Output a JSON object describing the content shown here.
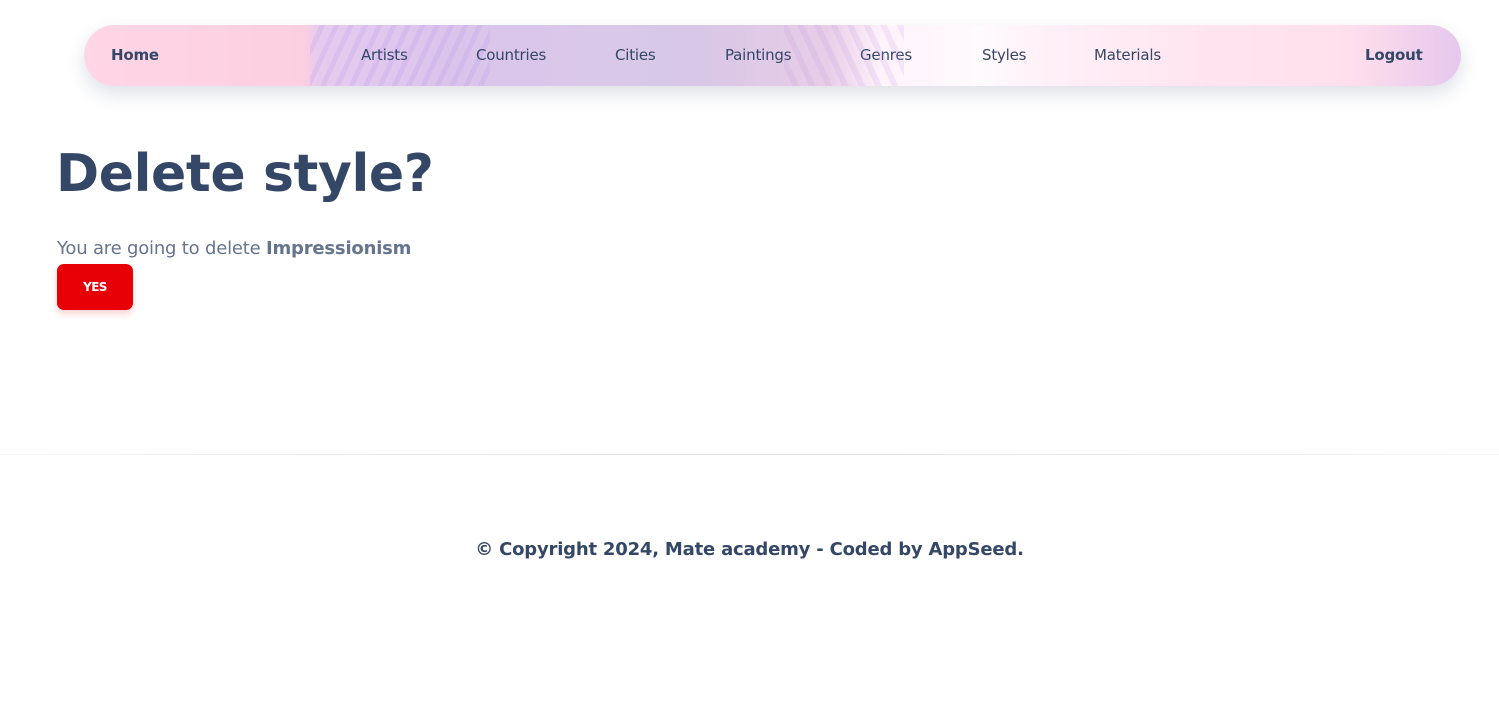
{
  "navigation": {
    "home": "Home",
    "artists": "Artists",
    "countries": "Countries",
    "cities": "Cities",
    "paintings": "Paintings",
    "genres": "Genres",
    "styles": "Styles",
    "materials": "Materials",
    "logout": "Logout"
  },
  "content": {
    "title": "Delete style?",
    "message_prefix": "You are going to delete ",
    "style_name": "Impressionism",
    "yes_button": "YES"
  },
  "footer": {
    "copyright": "© Copyright 2024, Mate academy - Coded by AppSeed."
  },
  "colors": {
    "heading": "#344767",
    "secondary_text": "#67748e",
    "danger_button": "#e80007",
    "navigation_pink": "#ffd6e6",
    "navigation_lavender": "#dbc4ec"
  }
}
